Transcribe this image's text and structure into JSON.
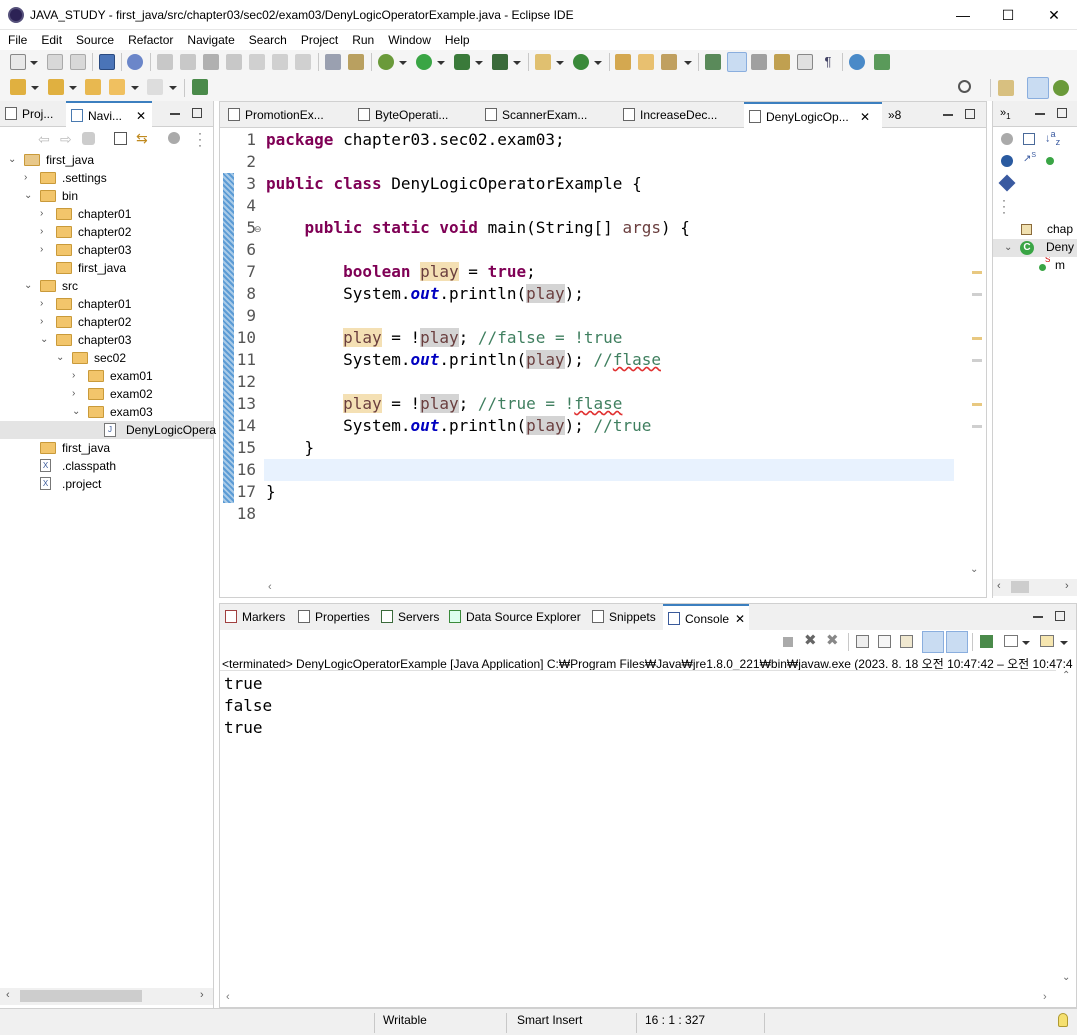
{
  "window": {
    "title": "JAVA_STUDY - first_java/src/chapter03/sec02/exam03/DenyLogicOperatorExample.java - Eclipse IDE",
    "minimize": "—",
    "maximize": "☐",
    "close": "✕"
  },
  "menu": [
    "File",
    "Edit",
    "Source",
    "Refactor",
    "Navigate",
    "Search",
    "Project",
    "Run",
    "Window",
    "Help"
  ],
  "left_tabs": [
    {
      "label": "Proj..."
    },
    {
      "label": "Navi..."
    }
  ],
  "tree": [
    {
      "label": "first_java",
      "depth": 0,
      "expanded": true,
      "kind": "project"
    },
    {
      "label": ".settings",
      "depth": 1,
      "expanded": false,
      "kind": "folder"
    },
    {
      "label": "bin",
      "depth": 1,
      "expanded": true,
      "kind": "folder"
    },
    {
      "label": "chapter01",
      "depth": 2,
      "expanded": false,
      "kind": "folder"
    },
    {
      "label": "chapter02",
      "depth": 2,
      "expanded": false,
      "kind": "folder"
    },
    {
      "label": "chapter03",
      "depth": 2,
      "expanded": false,
      "kind": "folder"
    },
    {
      "label": "first_java",
      "depth": 2,
      "expanded": null,
      "kind": "folder"
    },
    {
      "label": "src",
      "depth": 1,
      "expanded": true,
      "kind": "folder"
    },
    {
      "label": "chapter01",
      "depth": 2,
      "expanded": false,
      "kind": "folder"
    },
    {
      "label": "chapter02",
      "depth": 2,
      "expanded": false,
      "kind": "folder"
    },
    {
      "label": "chapter03",
      "depth": 2,
      "expanded": true,
      "kind": "folder"
    },
    {
      "label": "sec02",
      "depth": 3,
      "expanded": true,
      "kind": "folder"
    },
    {
      "label": "exam01",
      "depth": 4,
      "expanded": false,
      "kind": "folder"
    },
    {
      "label": "exam02",
      "depth": 4,
      "expanded": false,
      "kind": "folder"
    },
    {
      "label": "exam03",
      "depth": 4,
      "expanded": true,
      "kind": "folder"
    },
    {
      "label": "DenyLogicOpera",
      "depth": 5,
      "expanded": null,
      "kind": "file",
      "selected": true
    },
    {
      "label": "first_java",
      "depth": 1,
      "expanded": null,
      "kind": "folder"
    },
    {
      "label": ".classpath",
      "depth": 1,
      "expanded": null,
      "kind": "xfile"
    },
    {
      "label": ".project",
      "depth": 1,
      "expanded": null,
      "kind": "xfile"
    }
  ],
  "editor_tabs": [
    {
      "label": "PromotionEx..."
    },
    {
      "label": "ByteOperati..."
    },
    {
      "label": "ScannerExam..."
    },
    {
      "label": "IncreaseDec..."
    },
    {
      "label": "DenyLogicOp...",
      "active": true
    }
  ],
  "editor_overflow": "»8",
  "line_numbers": [
    "1",
    "2",
    "3",
    "4",
    "5",
    "6",
    "7",
    "8",
    "9",
    "10",
    "11",
    "12",
    "13",
    "14",
    "15",
    "16",
    "17",
    "18"
  ],
  "code": {
    "l1a": "package",
    "l1b": " chapter03.sec02.exam03;",
    "l3a": "public",
    "l3b": "class",
    "l3c": " DenyLogicOperatorExample {",
    "l5a": "public",
    "l5b": "static",
    "l5c": "void",
    "l5d": " main(String[] ",
    "l5e": "args",
    "l5f": ") {",
    "l7a": "boolean",
    "l7b": "play",
    "l7c": " = ",
    "l7d": "true",
    "l7e": ";",
    "l8a": "System.",
    "l8b": "out",
    "l8c": ".println(",
    "l8d": "play",
    "l8e": ");",
    "l10a": "play",
    "l10b": " = !",
    "l10c": "play",
    "l10d": "; ",
    "l10e": "//false = !true",
    "l11a": "System.",
    "l11b": "out",
    "l11c": ".println(",
    "l11d": "play",
    "l11e": "); ",
    "l11f": "//",
    "l11g": "flase",
    "l13a": "play",
    "l13b": " = !",
    "l13c": "play",
    "l13d": "; ",
    "l13e": "//true = !",
    "l13f": "flase",
    "l14a": "System.",
    "l14b": "out",
    "l14c": ".println(",
    "l14d": "play",
    "l14e": "); ",
    "l14f": "//true",
    "l15": "}",
    "l17": "}"
  },
  "outline": {
    "item1": "chap",
    "item2": "Deny",
    "item3": "m",
    "item3_sup": "S"
  },
  "console_tabs": [
    {
      "label": "Markers"
    },
    {
      "label": "Properties"
    },
    {
      "label": "Servers"
    },
    {
      "label": "Data Source Explorer"
    },
    {
      "label": "Snippets"
    },
    {
      "label": "Console",
      "active": true
    }
  ],
  "console_header": "<terminated> DenyLogicOperatorExample [Java Application] C:₩Program Files₩Java₩jre1.8.0_221₩bin₩javaw.exe  (2023. 8. 18 오전 10:47:42 – 오전 10:47:4",
  "console_output": [
    "true",
    "false",
    "true"
  ],
  "status": {
    "writable": "Writable",
    "insert": "Smart Insert",
    "position": "16 : 1 : 327"
  },
  "colors": {
    "keyword": "#7f0055",
    "comment": "#3f7f5f",
    "static_field": "#0000c0",
    "param": "#6a3e3e",
    "occurrence_write": "#f4e0b4",
    "occurrence_read": "#d4d4d4",
    "current_line": "#e8f2fe",
    "active_tab_border": "#3c7fbf"
  }
}
